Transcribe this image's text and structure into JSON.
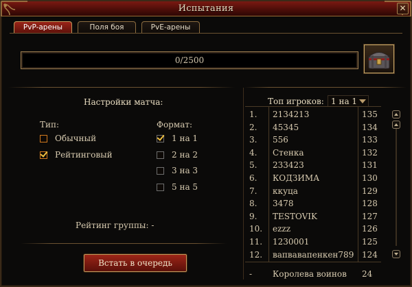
{
  "window": {
    "title": "Испытания"
  },
  "tabs": [
    {
      "label": "PvP-арены",
      "active": true
    },
    {
      "label": "Поля боя",
      "active": false
    },
    {
      "label": "PvE-арены",
      "active": false
    }
  ],
  "progress": {
    "text": "0/2500",
    "current": 0,
    "max": 2500
  },
  "reward": {
    "icon": "treasure-chest-icon"
  },
  "match": {
    "title": "Настройки матча:",
    "type_label": "Тип:",
    "format_label": "Формат:",
    "types": [
      {
        "label": "Обычный",
        "checked": false
      },
      {
        "label": "Рейтинговый",
        "checked": true
      }
    ],
    "formats": [
      {
        "label": "1 на 1",
        "checked": true
      },
      {
        "label": "2 на 2",
        "checked": false
      },
      {
        "label": "3 на 3",
        "checked": false
      },
      {
        "label": "5 на 5",
        "checked": false
      }
    ],
    "group_rating": "Рейтинг группы: -",
    "queue_button": "Встать в очередь"
  },
  "top": {
    "label": "Топ игроков:",
    "selected": "1 на 1",
    "rows": [
      {
        "rank": "1.",
        "name": "2134213",
        "score": "135"
      },
      {
        "rank": "2.",
        "name": "45345",
        "score": "134"
      },
      {
        "rank": "3.",
        "name": "556",
        "score": "133"
      },
      {
        "rank": "4.",
        "name": "Стенка",
        "score": "132"
      },
      {
        "rank": "5.",
        "name": "233423",
        "score": "131"
      },
      {
        "rank": "6.",
        "name": "КОДЗИМА",
        "score": "130"
      },
      {
        "rank": "7.",
        "name": "ккуца",
        "score": "129"
      },
      {
        "rank": "8.",
        "name": "3478",
        "score": "128"
      },
      {
        "rank": "9.",
        "name": "TESTOVIK",
        "score": "127"
      },
      {
        "rank": "10.",
        "name": "ezzz",
        "score": "126"
      },
      {
        "rank": "11.",
        "name": "1230001",
        "score": "125"
      },
      {
        "rank": "12.",
        "name": "вапвавапенкен789",
        "score": "124"
      }
    ],
    "self": {
      "rank": "-",
      "name": "Королева воинов",
      "score": "24"
    }
  },
  "colors": {
    "accent_red": "#7a1a12",
    "gold": "#c19a5c",
    "checkbox_type": "#d37a1e",
    "checkbox_format": "#6e6e6e",
    "check": "#f0c040"
  }
}
